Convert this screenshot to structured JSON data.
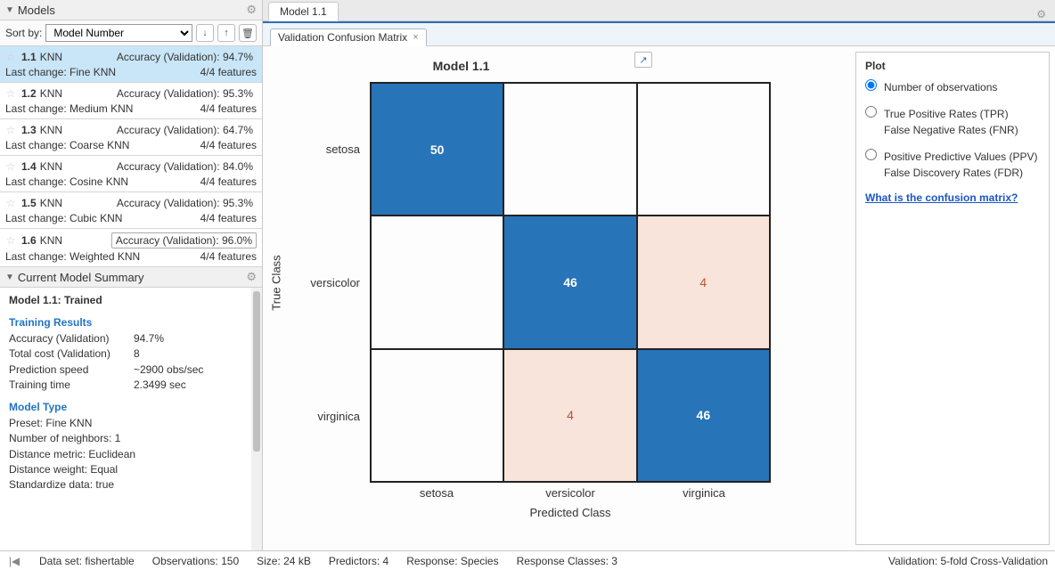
{
  "sidebar": {
    "title": "Models",
    "sort_label": "Sort by:",
    "sort_value": "Model Number",
    "items": [
      {
        "id": "1.1",
        "name": "KNN",
        "acc_label": "Accuracy (Validation):",
        "acc": "94.7%",
        "change": "Last change: Fine KNN",
        "features": "4/4 features",
        "selected": true,
        "boxed": false
      },
      {
        "id": "1.2",
        "name": "KNN",
        "acc_label": "Accuracy (Validation):",
        "acc": "95.3%",
        "change": "Last change: Medium KNN",
        "features": "4/4 features",
        "selected": false,
        "boxed": false
      },
      {
        "id": "1.3",
        "name": "KNN",
        "acc_label": "Accuracy (Validation):",
        "acc": "64.7%",
        "change": "Last change: Coarse KNN",
        "features": "4/4 features",
        "selected": false,
        "boxed": false
      },
      {
        "id": "1.4",
        "name": "KNN",
        "acc_label": "Accuracy (Validation):",
        "acc": "84.0%",
        "change": "Last change: Cosine KNN",
        "features": "4/4 features",
        "selected": false,
        "boxed": false
      },
      {
        "id": "1.5",
        "name": "KNN",
        "acc_label": "Accuracy (Validation):",
        "acc": "95.3%",
        "change": "Last change: Cubic KNN",
        "features": "4/4 features",
        "selected": false,
        "boxed": false
      },
      {
        "id": "1.6",
        "name": "KNN",
        "acc_label": "Accuracy (Validation):",
        "acc": "96.0%",
        "change": "Last change: Weighted KNN",
        "features": "4/4 features",
        "selected": false,
        "boxed": true
      }
    ]
  },
  "summary": {
    "header": "Current Model Summary",
    "title": "Model 1.1: Trained",
    "training_results_h": "Training Results",
    "rows1": [
      {
        "k": "Accuracy (Validation)",
        "v": "94.7%"
      },
      {
        "k": "Total cost (Validation)",
        "v": "8"
      },
      {
        "k": "Prediction speed",
        "v": "~2900 obs/sec"
      },
      {
        "k": "Training time",
        "v": "2.3499 sec"
      }
    ],
    "model_type_h": "Model Type",
    "rows2": [
      "Preset: Fine KNN",
      "Number of neighbors: 1",
      "Distance metric: Euclidean",
      "Distance weight: Equal",
      "Standardize data: true"
    ]
  },
  "content": {
    "tab": "Model 1.1",
    "subtab": "Validation Confusion Matrix",
    "chart_title": "Model 1.1",
    "y_axis": "True Class",
    "x_axis": "Predicted Class"
  },
  "plot_panel": {
    "title": "Plot",
    "opt1": "Number of observations",
    "opt2a": "True Positive Rates (TPR)",
    "opt2b": "False Negative Rates (FNR)",
    "opt3a": "Positive Predictive Values (PPV)",
    "opt3b": "False Discovery Rates (FDR)",
    "link": "What is the confusion matrix?"
  },
  "status": {
    "dataset": "Data set: fishertable",
    "obs": "Observations: 150",
    "size": "Size: 24 kB",
    "predictors": "Predictors: 4",
    "response": "Response: Species",
    "classes": "Response Classes: 3",
    "validation": "Validation: 5-fold Cross-Validation"
  },
  "chart_data": {
    "type": "heatmap",
    "title": "Model 1.1",
    "xlabel": "Predicted Class",
    "ylabel": "True Class",
    "categories_x": [
      "setosa",
      "versicolor",
      "virginica"
    ],
    "categories_y": [
      "setosa",
      "versicolor",
      "virginica"
    ],
    "matrix": [
      [
        50,
        0,
        0
      ],
      [
        0,
        46,
        4
      ],
      [
        0,
        4,
        46
      ]
    ],
    "cell_display": [
      [
        "50",
        "",
        ""
      ],
      [
        "",
        "46",
        "4"
      ],
      [
        "",
        "4",
        "46"
      ]
    ]
  }
}
